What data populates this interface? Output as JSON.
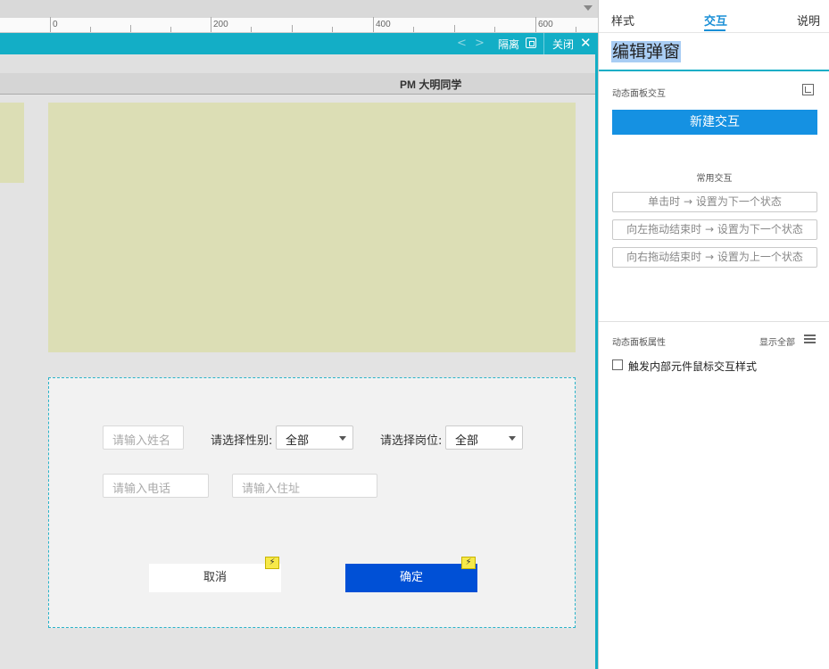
{
  "ruler": {
    "labels": [
      "0",
      "200",
      "400",
      "600"
    ]
  },
  "toolbar": {
    "isolate_label": "隔离",
    "close_label": "关闭",
    "prev": "<",
    "next": ">",
    "close_x": "✕"
  },
  "header": {
    "user_name": "PM 大明同学"
  },
  "form": {
    "name_placeholder": "请输入姓名",
    "gender_label": "请选择性别:",
    "gender_value": "全部",
    "post_label": "请选择岗位:",
    "post_value": "全部",
    "phone_placeholder": "请输入电话",
    "address_placeholder": "请输入住址",
    "cancel_label": "取消",
    "ok_label": "确定",
    "bolt": "⚡"
  },
  "right_panel": {
    "tabs": [
      {
        "label": "样式"
      },
      {
        "label": "交互"
      },
      {
        "label": "说明"
      }
    ],
    "title": "编辑弹窗",
    "interaction_section": "动态面板交互",
    "new_interaction": "新建交互",
    "common_section": "常用交互",
    "common_items": [
      {
        "label": "单击时 → 设置为下一个状态"
      },
      {
        "label": "向左拖动结束时 → 设置为下一个状态"
      },
      {
        "label": "向右拖动结束时 → 设置为上一个状态"
      }
    ],
    "props_section": "动态面板属性",
    "show_all": "显示全部",
    "checkbox_label": "触发内部元件鼠标交互样式"
  },
  "colors": {
    "accent": "#13aec6",
    "primary_button": "#0050d6",
    "new_button": "#1591e2",
    "panel_fill": "#dcdeb5",
    "active_tab": "#1a8fd6"
  }
}
